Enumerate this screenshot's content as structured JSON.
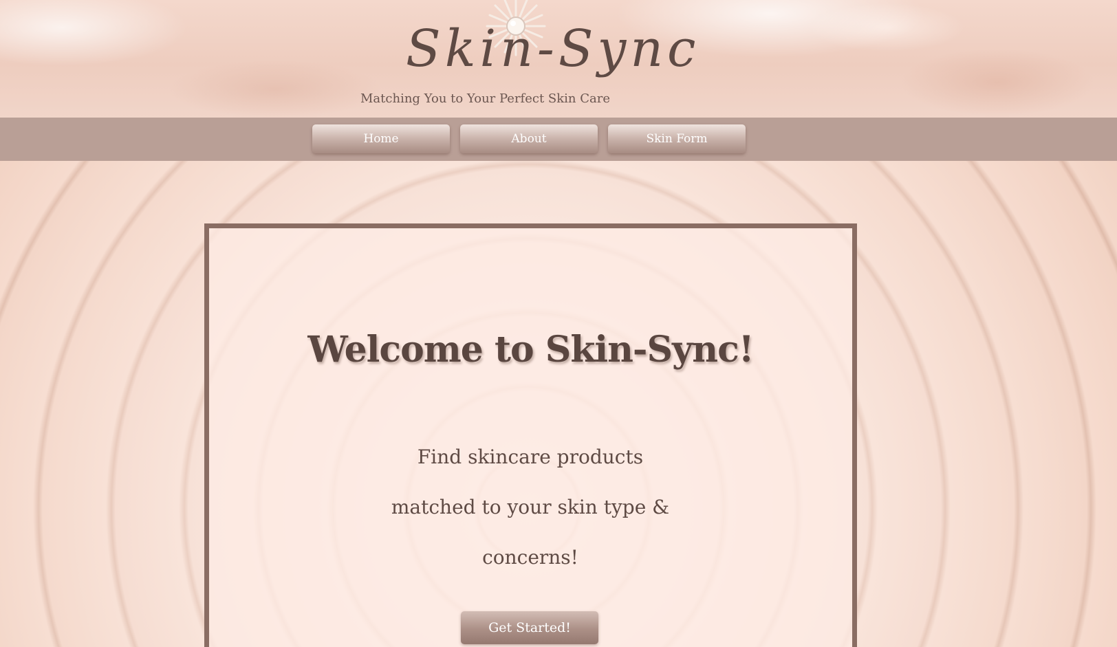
{
  "header": {
    "logo_text": "Skin-Sync",
    "tagline": "Matching You to Your Perfect Skin Care"
  },
  "nav": {
    "items": [
      {
        "label": "Home"
      },
      {
        "label": "About"
      },
      {
        "label": "Skin Form"
      }
    ]
  },
  "main": {
    "title": "Welcome to Skin-Sync!",
    "subtitle": "Find skincare products matched to your skin type & concerns!",
    "cta_label": "Get Started!"
  },
  "icons": {
    "logo_mark": "sun-icon"
  },
  "colors": {
    "nav_bar": "#b99f96",
    "card_border": "#8a6d63",
    "heading_text": "#5a4640",
    "button_text": "#ffffff"
  }
}
